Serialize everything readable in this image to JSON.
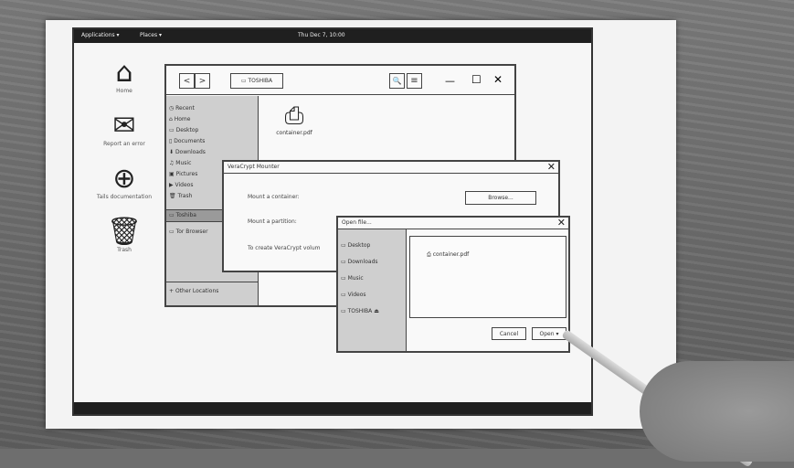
{
  "topbar": {
    "applications": "Applications ▾",
    "places": "Places ▾",
    "clock": "Thu Dec 7, 10:00"
  },
  "desktop_icons": [
    {
      "label": "Home",
      "icon": "home-icon"
    },
    {
      "label": "Report an error",
      "icon": "mail-icon"
    },
    {
      "label": "Tails documentation",
      "icon": "lifebuoy-icon"
    },
    {
      "label": "Trash",
      "icon": "trash-icon"
    }
  ],
  "file_manager": {
    "back": "<",
    "forward": ">",
    "location": "TOSHIBA",
    "search_glyph": "🔍",
    "menu_glyph": "≡",
    "minimize": "—",
    "maximize": "☐",
    "close": "✕",
    "sidebar": [
      "Recent",
      "Home",
      "Desktop",
      "Documents",
      "Downloads",
      "Music",
      "Pictures",
      "Videos",
      "Trash",
      "Toshiba",
      "Tor Browser"
    ],
    "other_locations": "Other Locations",
    "file_name": "container.pdf"
  },
  "veracrypt": {
    "title": "VeraCrypt Mounter",
    "mount_container": "Mount a container:",
    "browse": "Browse...",
    "mount_partition": "Mount a partition:",
    "create_text": "To create VeraCrypt volum"
  },
  "open_dialog": {
    "title": "Open file...",
    "places": [
      "Desktop",
      "Downloads",
      "Music",
      "Videos",
      "TOSHIBA"
    ],
    "file": "container.pdf",
    "cancel": "Cancel",
    "open": "Open"
  },
  "colors": {
    "bar": "#1f1f1f",
    "sidebar": "#cfcfcf",
    "paper": "#f3f3f3"
  }
}
